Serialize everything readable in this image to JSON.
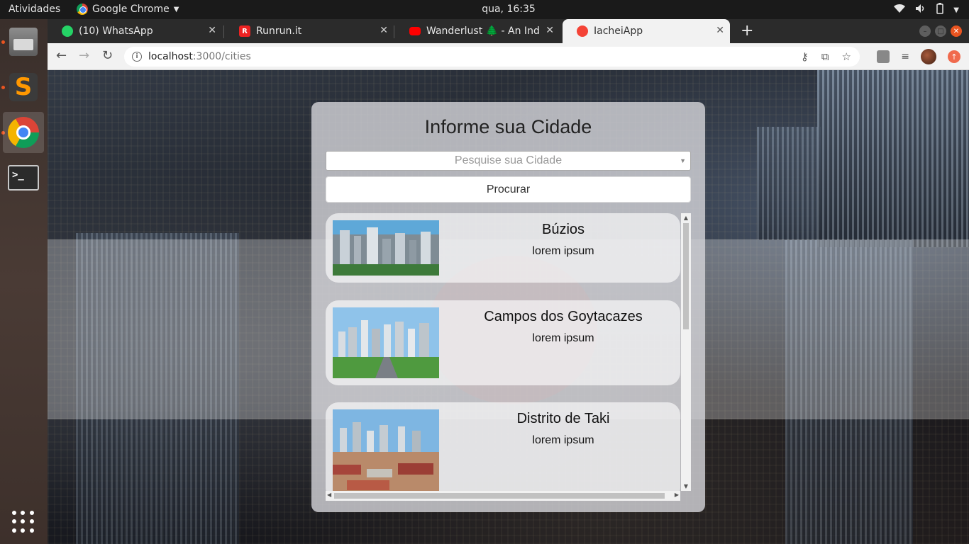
{
  "os": {
    "activities": "Atividades",
    "app_name": "Google Chrome",
    "clock": "qua, 16:35"
  },
  "browser": {
    "tabs": [
      {
        "label": "(10) WhatsApp",
        "favicon": "whatsapp-icon"
      },
      {
        "label": "Runrun.it",
        "favicon": "runrun-icon"
      },
      {
        "label": "Wanderlust 🌲 - An Ind",
        "favicon": "youtube-icon"
      },
      {
        "label": "IacheiApp",
        "favicon": "iacheiapp-icon"
      }
    ],
    "url_host": "localhost",
    "url_path": ":3000/cities"
  },
  "page": {
    "title": "Informe sua Cidade",
    "search_placeholder": "Pesquise sua Cidade",
    "search_button": "Procurar",
    "cities": [
      {
        "name": "Búzios",
        "description": "lorem ipsum"
      },
      {
        "name": "Campos dos Goytacazes",
        "description": "lorem ipsum"
      },
      {
        "name": "Distrito de Taki",
        "description": "lorem ipsum"
      }
    ]
  },
  "colors": {
    "ubuntu_orange": "#e95420",
    "panel_bg": "#d2d2d7"
  }
}
